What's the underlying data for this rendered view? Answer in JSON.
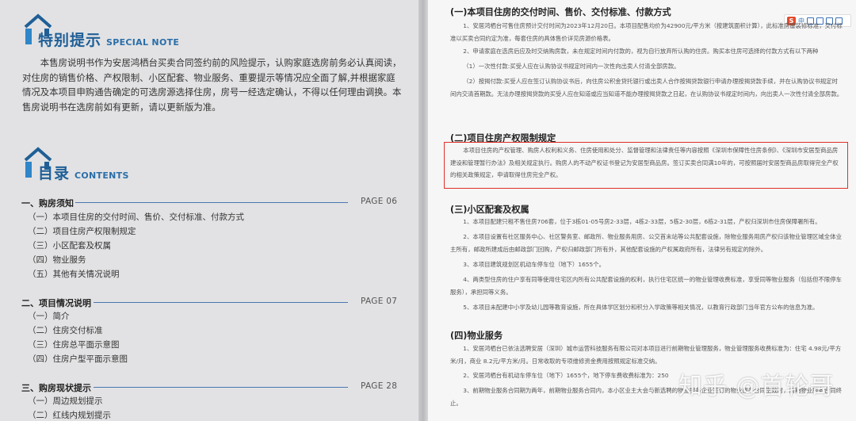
{
  "left": {
    "notice": {
      "title": "特别提示",
      "title_en": "SPECIAL NOTE",
      "body": "本售房说明书作为安居鸿栖台买卖合同签约前的风险提示，认购家庭选房前务必认真阅读，对住房的销售价格、产权限制、小区配套、物业服务、重要提示等情况应全面了解,并根据家庭情况及本项目申购通告确定的可选房源选择住房，房号一经选定确认，不得以任何理由调换。本售房说明书在选房前如有更新，请以更新版为准。"
    },
    "contents": {
      "title": "目录",
      "title_en": "CONTENTS",
      "sections": [
        {
          "heading": "一、购房须知",
          "page": "PAGE 06",
          "items": [
            "（一）本项目住房的交付时间、售价、交付标准、付款方式",
            "（二）项目住房产权限制规定",
            "（三）小区配套及权属",
            "（四）物业服务",
            "（五）其他有关情况说明"
          ]
        },
        {
          "heading": "二、项目情况说明",
          "page": "PAGE 07",
          "items": [
            "（一）简介",
            "（二）住房交付标准",
            "（三）住房总平面示意图",
            "（四）住房户型平面示意图"
          ]
        },
        {
          "heading": "三、购房现状提示",
          "page": "PAGE 28",
          "items": [
            "（一）周边规划提示",
            "（二）红线内规划提示"
          ]
        }
      ]
    }
  },
  "right": {
    "s1": {
      "heading": "(一)本项目住房的交付时间、售价、交付标准、付款方式",
      "p1": "1、安居鸿栖台可售住房预计交付时间为2023年12月20日。本项目配售均价为42900元/平方米（按建筑面积计算），此标准房屋装修标准，交付标准以买卖合同约定为准，每套住房的具体售价详见房源价格表。",
      "p2": "2、申请家庭在选房后应及时交纳购房款，未在规定时间内付款的，视为自行放弃所认购的住房。购买本住房可选择的付款方式有以下两种",
      "p3": "（1）一次性付款:买受人应在认购协议书规定时间内一次性向出卖人付清全部房款。",
      "p4": "（2）按揭付款:买受人应在签订认购协议书后，向住房公积金贷托银行或出卖人合作按揭贷款银行申请办理按揭贷款手续，并在认购协议书规定时间内交清首期款。无法办理按揭贷款的买受人应在知道或应当知道不能办理按揭贷款之日起，在认购协议书规定时间内，向出卖人一次性付清全部房款。"
    },
    "s2": {
      "heading": "(二)项目住房产权限制规定",
      "p1": "本项目住房的产权管理、购房人权利和义务、住房使用和处分、监督管理和法律责任等内容按照《深圳市保障性住房条例》、《深圳市安居型商品房建设和管理暂行办法》及相关规定执行。购房人的不动产权证书登记为安居型商品房。签订买卖合同满10年的，可按照届时安居型商品房取得完全产权的相关政策规定，申请取得住房完全产权。"
    },
    "s3": {
      "heading": "(三)小区配套及权属",
      "p1": "1、本项目配建只租不售住房706套，位于3栋01-05号房2-33层，4栋2-33层，5栋2-30层，6栋2-31层，产权归深圳市住房保障署所有。",
      "p2": "2、本项目设置有社区服务中心、社区警务室、邮政所、物业服务用房、公交首末站等公共配套设施，除物业服务用房产权归该物业管理区域全体业主所有，邮政所建成后由邮政部门回购，产权归邮政部门所有外，其他配套设施的产权属政府所有，法律另有规定的除外。",
      "p3": "3、本项目建筑规划区机动车停车位（地下）1655个。",
      "p4": "4、两类型住房的住户享有同等使用住宅区内所有公共配套设施的权利，执行住宅区统一的物业管理收费标准，享受同等物业服务（包括但不限停车服务），承担同等义务。",
      "p5": "5、本项目未配建中小学及幼儿园等教育设施，所在具体学区划分和积分入学政策等相关情况，以教育行政部门当年官方公布的信息为准。"
    },
    "s4": {
      "heading": "(四)物业服务",
      "p1": "1、安居鸿栖台已依法选聘安居（深圳）城市运营科技服务有限公司对本项目进行前期物业管理服务，物业管理服务收费标准为：住宅 4.98元/平方米/月，商业 8.2元/平方米/月。日常收取的专项维修资金费用按照规定标准交纳。",
      "p2": "2、安居鸿栖台有机动车停车位（地下）1655个，地下停车费收费标准为：250",
      "p3": "3、前期物业服务合同期为两年，前期物业服务合同内，本小区业主大会与新选聘的物业服务企业签订的物业服务合同生效时，前期物业服务合同终止。"
    },
    "toolbar": [
      "S",
      "中"
    ],
    "watermark": "知乎 @首轮哥"
  },
  "colors": {
    "accent": "#1f5f96",
    "highlight_border": "#e0302a"
  }
}
